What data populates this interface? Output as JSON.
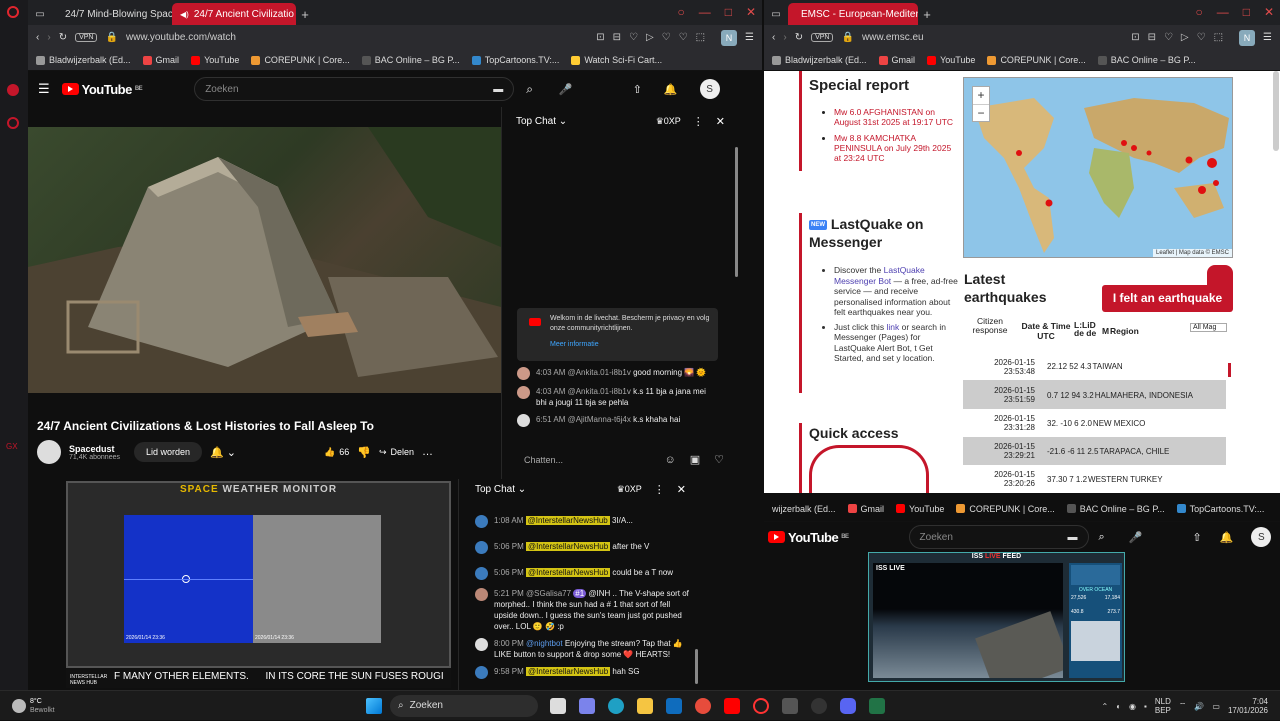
{
  "left_browser": {
    "tabs": [
      {
        "label": "24/7 Mind-Blowing Space"
      },
      {
        "label": "24/7 Ancient Civilizatio"
      }
    ],
    "vpn": "VPN",
    "url": "www.youtube.com/watch",
    "bookmarks": [
      "Bladwijzerbalk (Ed...",
      "Gmail",
      "YouTube",
      "COREPUNK | Core...",
      "BAC Online – BG P...",
      "TopCartoons.TV:...",
      "Watch Sci-Fi Cart..."
    ]
  },
  "youtube": {
    "logo": "YouTube",
    "region": "BE",
    "search_placeholder": "Zoeken",
    "avatar": "S",
    "video_title": "24/7 Ancient Civilizations & Lost Histories to Fall Asleep To",
    "channel": "Spacedust",
    "subscribers": "71,4K abonnees",
    "join": "Lid worden",
    "likes": "66",
    "share": "Delen"
  },
  "chat1": {
    "header": "Top Chat",
    "xp": "0XP",
    "welcome": "Welkom in de livechat. Bescherm je privacy en volg onze communityrichtlijnen.",
    "more": "Meer informatie",
    "messages": [
      {
        "time": "4:03 AM",
        "name": "@Ankita.01-i8b1v",
        "text": "good morning 🌄 🌞"
      },
      {
        "time": "4:03 AM",
        "name": "@Ankita.01-i8b1v",
        "text": "k.s 11 bja a jana mei bhi a jougi 11 bja se pehla"
      },
      {
        "time": "6:51 AM",
        "name": "@AjitManna-t6j4x",
        "text": "k.s khaha hai"
      }
    ],
    "input_placeholder": "Chatten..."
  },
  "space_weather": {
    "title_a": "SPACE",
    "title_b": "WEATHER MONITOR",
    "img1_date": "2026/01/14 23:36",
    "img2_date": "2026/01/14 23:36",
    "ticker": "F MANY OTHER ELEMENTS.      IN ITS CORE THE SUN FUSES ROUGI",
    "logo": "INTERSTELLAR NEWS HUB"
  },
  "chat2": {
    "header": "Top Chat",
    "xp": "0XP",
    "messages": [
      {
        "time": "1:08 AM",
        "name": "@InterstellarNewsHub",
        "text": "3I/A..."
      },
      {
        "time": "5:06 PM",
        "name": "@InterstellarNewsHub",
        "text": "after the V"
      },
      {
        "time": "5:06 PM",
        "name": "@InterstellarNewsHub",
        "text": "could be a T now"
      },
      {
        "time": "5:21 PM",
        "name": "@SGalisa77",
        "badge": "#1",
        "text": "@INH .. The V-shape sort of morphed.. I think the sun had a # 1 that sort of fell upside down.. I guess the sun's team just got pushed over.. LOL 🙂 🤣 :p"
      },
      {
        "time": "8:00 PM",
        "name": "@nightbot",
        "text": "Enjoying the stream? Tap that 👍 LIKE button to support & drop some ❤️ HEARTS!"
      },
      {
        "time": "9:58 PM",
        "name": "@InterstellarNewsHub",
        "text": "hah SG"
      }
    ]
  },
  "right_browser": {
    "tab": "EMSC - European-Mediter",
    "vpn": "VPN",
    "url": "www.emsc.eu",
    "bookmarks": [
      "Bladwijzerbalk (Ed...",
      "Gmail",
      "YouTube",
      "COREPUNK | Core...",
      "BAC Online – BG P..."
    ]
  },
  "emsc": {
    "special_title": "Special report",
    "special_links": [
      "Mw 6.0 AFGHANISTAN on August 31st 2025 at 19:17 UTC",
      "Mw 8.8 KAMCHATKA PENINSULA on July 29th 2025 at 23:24 UTC"
    ],
    "lastquake_new": "NEW",
    "lastquake_title": "LastQuake on Messenger",
    "lq_item1_a": "Discover the",
    "lq_item1_link": "LastQuake Messenger Bot",
    "lq_item1_b": "— a free, ad-free service — and receive personalised information about felt earthquakes near you.",
    "lq_item2_a": "Just click this",
    "lq_item2_link": "link",
    "lq_item2_b": "or search in Messenger (Pages) for LastQuake Alert Bot, t Get Started, and set y location.",
    "quick_access": "Quick access",
    "map_plus": "+",
    "map_minus": "−",
    "map_attrib": "Leaflet | Map data © EMSC",
    "latest_title": "Latest earthquakes",
    "felt_button": "I felt an earthquake",
    "col_citizen": "Citizen response",
    "col_datetime": "Date & Time UTC",
    "col_latlon": "L:LiD de de",
    "col_mag": "M",
    "col_region": "Region",
    "filter": "All Mag",
    "quakes": [
      {
        "date": "2026-01-15",
        "time": "23:53:48",
        "vals": "22.12 52 4.3",
        "region": "TAIWAN"
      },
      {
        "date": "2026-01-15",
        "time": "23:51:59",
        "vals": "0.7 12 94 3.2",
        "region": "HALMAHERA, INDONESIA"
      },
      {
        "date": "2026-01-15",
        "time": "23:31:28",
        "vals": "32. -10 6 2.0",
        "region": "NEW MEXICO"
      },
      {
        "date": "2026-01-15",
        "time": "23:29:21",
        "vals": "-21.6 -6 11 2.5",
        "region": "TARAPACA, CHILE"
      },
      {
        "date": "2026-01-15",
        "time": "23:20:26",
        "vals": "37.30 7 1.2",
        "region": "WESTERN TURKEY"
      }
    ]
  },
  "iss": {
    "bookmarks": [
      "wijzerbalk (Ed...",
      "Gmail",
      "YouTube",
      "COREPUNK | Core...",
      "BAC Online – BG P...",
      "TopCartoons.TV:..."
    ],
    "logo": "YouTube",
    "region": "BE",
    "search": "Zoeken",
    "avatar": "S",
    "feed_title_a": "ISS ",
    "feed_title_b": "LIVE",
    "feed_title_c": " FEED",
    "iss_live": "ISS LIVE",
    "over": "OVER OCEAN",
    "stats": [
      "27,526",
      "17,184",
      "430.8",
      "273.7"
    ]
  },
  "taskbar": {
    "weather_temp": "8°C",
    "weather_desc": "Bewolkt",
    "search": "Zoeken",
    "lang1": "NLD",
    "lang2": "BEP",
    "time": "7:04",
    "date": "17/01/2026"
  }
}
